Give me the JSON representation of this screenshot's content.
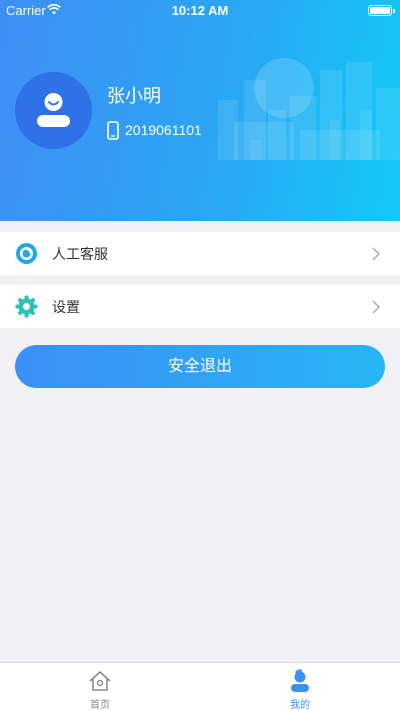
{
  "status_bar": {
    "carrier": "Carrier",
    "time": "10:12 AM",
    "battery_level": 1.0
  },
  "profile": {
    "name": "张小明",
    "phone": "2019061101",
    "avatar_icon": "user-avatar-icon",
    "phone_icon": "mobile-phone-icon"
  },
  "menu": {
    "items": [
      {
        "label": "人工客服",
        "icon": "customer-service-icon"
      },
      {
        "label": "设置",
        "icon": "gear-icon"
      }
    ]
  },
  "logout_label": "安全退出",
  "tabbar": {
    "tabs": [
      {
        "label": "首页",
        "icon": "home-icon",
        "active": false
      },
      {
        "label": "我的",
        "icon": "profile-icon",
        "active": true
      }
    ]
  },
  "colors": {
    "header_gradient_start": "#3f8ef5",
    "header_gradient_end": "#12c9f8",
    "avatar_bg": "#2f72e7",
    "accent": "#3b8ff5",
    "service_icon": "#1fa7e6",
    "settings_icon": "#2cc3b2",
    "page_bg": "#f0f0f5"
  }
}
